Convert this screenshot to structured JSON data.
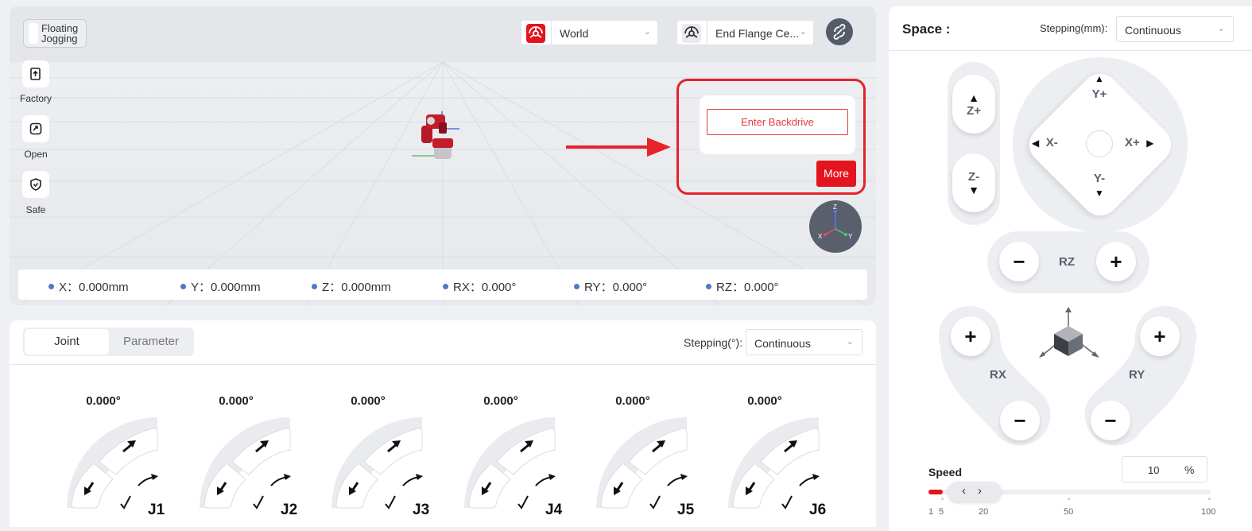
{
  "viewport": {
    "floating_jogging": "Floating Jogging",
    "coord_frame": {
      "selected": "World",
      "icon": "robot-frame-icon"
    },
    "tool_frame": {
      "selected": "End Flange Ce...",
      "icon": "tool-frame-icon"
    },
    "side_buttons": [
      {
        "label": "Factory",
        "icon": "factory-icon"
      },
      {
        "label": "Open",
        "icon": "open-icon"
      },
      {
        "label": "Safe",
        "icon": "shield-icon"
      }
    ],
    "coords": [
      {
        "label": "X",
        "value": "0.000mm"
      },
      {
        "label": "Y",
        "value": "0.000mm"
      },
      {
        "label": "Z",
        "value": "0.000mm"
      },
      {
        "label": "RX",
        "value": "0.000°"
      },
      {
        "label": "RY",
        "value": "0.000°"
      },
      {
        "label": "RZ",
        "value": "0.000°"
      }
    ],
    "popup": {
      "backdrive_label": "Enter Backdrive",
      "more_label": "More"
    },
    "axis_gizmo": {
      "z": "Z",
      "x": "X",
      "y": "Y"
    }
  },
  "joint_panel": {
    "tabs": [
      "Joint",
      "Parameter"
    ],
    "active_tab": "Joint",
    "stepping_label": "Stepping(°):",
    "stepping_value": "Continuous",
    "joints": [
      {
        "name": "J1",
        "value": "0.000°"
      },
      {
        "name": "J2",
        "value": "0.000°"
      },
      {
        "name": "J3",
        "value": "0.000°"
      },
      {
        "name": "J4",
        "value": "0.000°"
      },
      {
        "name": "J5",
        "value": "0.000°"
      },
      {
        "name": "J6",
        "value": "0.000°"
      }
    ]
  },
  "space_panel": {
    "title": "Space :",
    "stepping_label": "Stepping(mm):",
    "stepping_value": "Continuous",
    "labels": {
      "z_plus": "Z+",
      "z_minus": "Z-",
      "y_plus": "Y+",
      "y_minus": "Y-",
      "x_plus": "X+",
      "x_minus": "X-",
      "rz": "RZ",
      "rx": "RX",
      "ry": "RY"
    },
    "speed": {
      "label": "Speed",
      "value": "10",
      "unit": "%",
      "fill_fraction": 0.05,
      "ticks": [
        "1",
        "5",
        "20",
        "50",
        "100"
      ]
    }
  },
  "colors": {
    "accent": "#e4141f",
    "dot": "#4f78c4",
    "gizmo": "#5a5f6e"
  }
}
